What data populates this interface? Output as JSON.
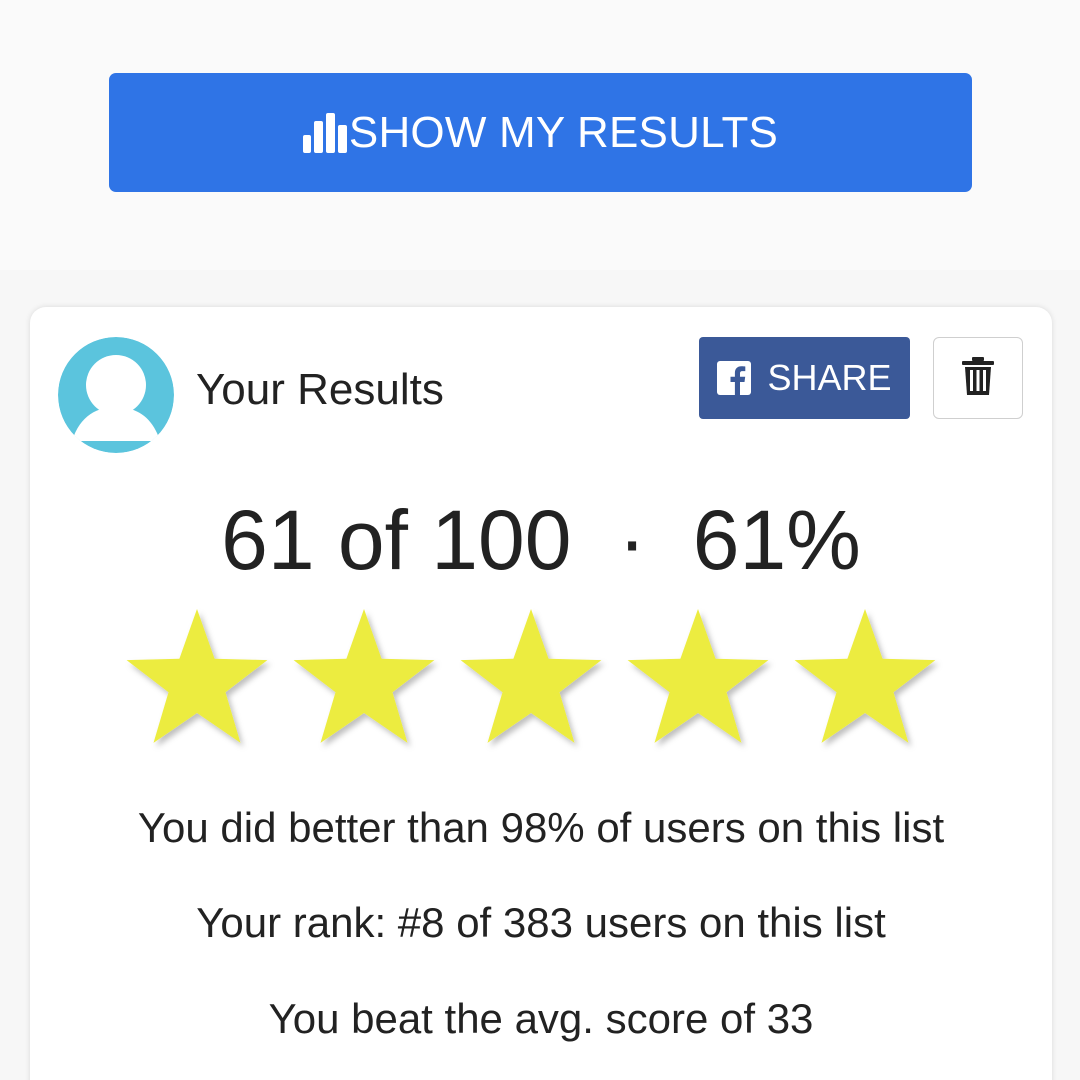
{
  "colors": {
    "primary_button": "#2f74e6",
    "facebook": "#3b5998",
    "avatar": "#5bc4dd",
    "star": "#ecec3f"
  },
  "results_button": {
    "label": "SHOW MY RESULTS",
    "icon": "bar-chart-icon"
  },
  "card": {
    "title": "Your Results",
    "avatar_icon": "user-avatar-icon",
    "share": {
      "label": "SHARE",
      "icon": "facebook-icon"
    },
    "delete": {
      "icon": "trash-icon"
    },
    "score": {
      "correct": "61",
      "total": "100",
      "percent": "61%",
      "text": "61 of 100  ·  61%"
    },
    "rating": {
      "stars_filled": 5,
      "stars_total": 5
    },
    "stats": [
      "You did better than 98% of users on this list",
      "Your rank: #8 of 383 users on this list",
      "You beat the avg. score of 33"
    ]
  }
}
